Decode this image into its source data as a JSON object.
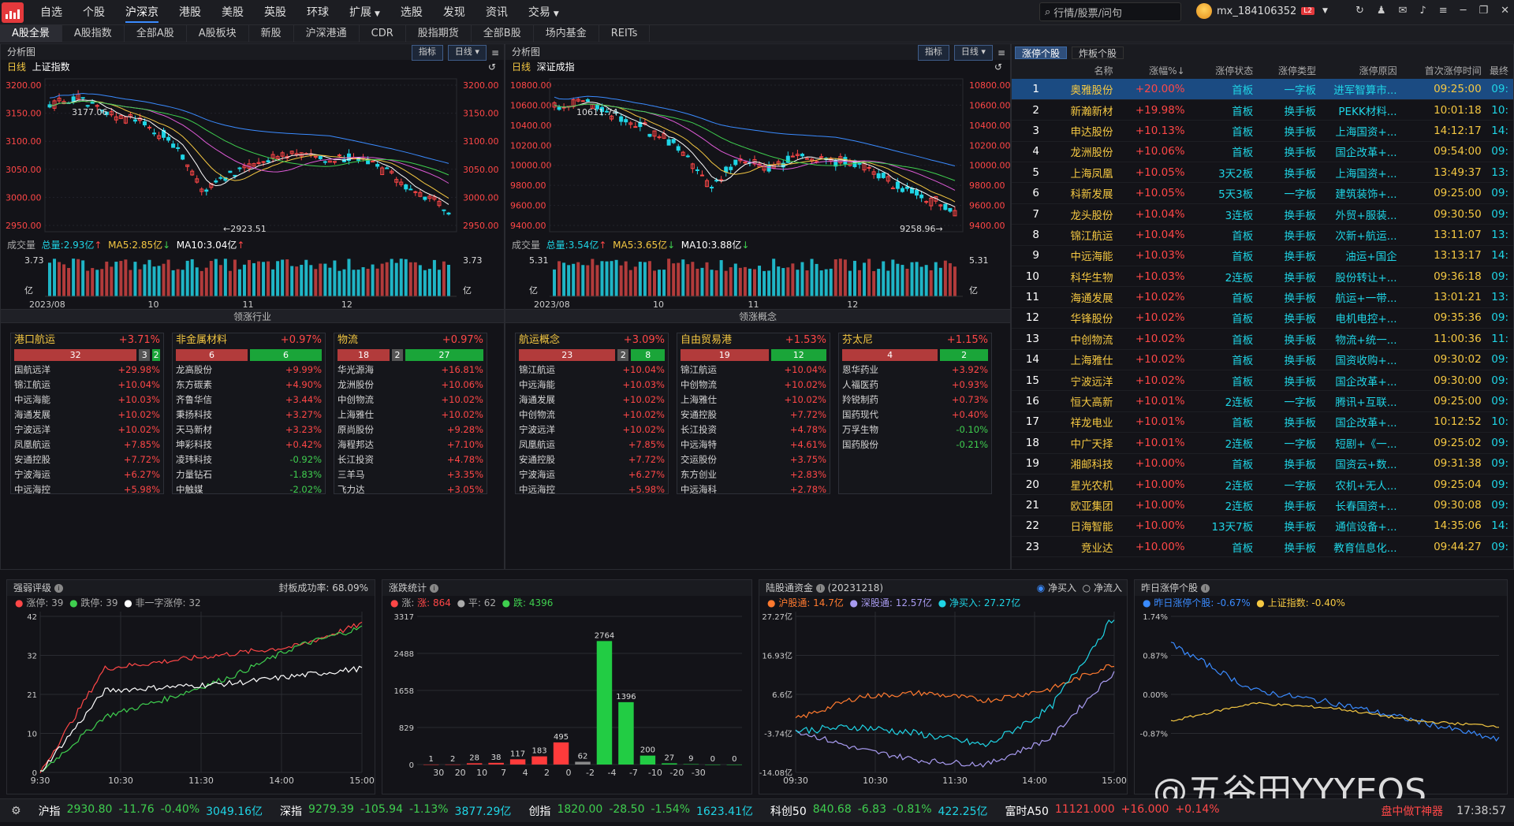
{
  "app": {
    "nav": [
      "自选",
      "个股",
      "沪深京",
      "港股",
      "美股",
      "英股",
      "环球",
      "扩展",
      "选股",
      "发现",
      "资讯",
      "交易"
    ],
    "nav_active": 2,
    "search_placeholder": "行情/股票/问句",
    "username": "mx_184106352",
    "level": "L2"
  },
  "tabs": [
    "A股全景",
    "A股指数",
    "全部A股",
    "A股板块",
    "新股",
    "沪深港通",
    "CDR",
    "股指期货",
    "全部B股",
    "场内基金",
    "REITs"
  ],
  "left_chart": {
    "title": "分析图",
    "btn1": "指标",
    "btn2": "日线",
    "period": "日线",
    "name": "上证指数",
    "high_label": "3177.06",
    "low_label": "←2923.51",
    "yticks": [
      "3200.00",
      "3150.00",
      "3100.00",
      "3050.00",
      "3000.00",
      "2950.00"
    ],
    "vol_label": "成交量",
    "vol_total": "总量:2.93亿",
    "vol_ma5": "MA5:2.85亿",
    "vol_ma10": "MA10:3.04亿",
    "vol_max": "3.73",
    "vol_unit": "亿",
    "xticks": [
      "2023/08",
      "10",
      "11",
      "12"
    ],
    "section": "领涨行业"
  },
  "right_chart": {
    "title": "分析图",
    "btn1": "指标",
    "btn2": "日线",
    "period": "日线",
    "name": "深证成指",
    "high_label": "10611.74",
    "low_label": "9258.96→",
    "yticks": [
      "10800.00",
      "10600.00",
      "10400.00",
      "10200.00",
      "10000.00",
      "9800.00",
      "9600.00",
      "9400.00"
    ],
    "vol_label": "成交量",
    "vol_total": "总量:3.54亿",
    "vol_ma5": "MA5:3.65亿",
    "vol_ma10": "MA10:3.88亿",
    "vol_max": "5.31",
    "vol_unit": "亿",
    "xticks": [
      "2023/08",
      "10",
      "11",
      "12"
    ],
    "section": "领涨概念"
  },
  "industry_boxes": [
    {
      "name": "港口航运",
      "pct": "+3.71%",
      "up": "32",
      "flat": "3",
      "down": "2",
      "rows": [
        [
          "国航远洋",
          "+29.98%"
        ],
        [
          "锦江航运",
          "+10.04%"
        ],
        [
          "中远海能",
          "+10.03%"
        ],
        [
          "海通发展",
          "+10.02%"
        ],
        [
          "宁波远洋",
          "+10.02%"
        ],
        [
          "凤凰航运",
          "+7.85%"
        ],
        [
          "安通控股",
          "+7.72%"
        ],
        [
          "宁波海运",
          "+6.27%"
        ],
        [
          "中远海控",
          "+5.98%"
        ]
      ]
    },
    {
      "name": "非金属材料",
      "pct": "+0.97%",
      "up": "6",
      "flat": "",
      "down": "6",
      "rows": [
        [
          "龙高股份",
          "+9.99%"
        ],
        [
          "东方碳素",
          "+4.90%"
        ],
        [
          "齐鲁华信",
          "+3.44%"
        ],
        [
          "秉扬科技",
          "+3.27%"
        ],
        [
          "天马新材",
          "+3.23%"
        ],
        [
          "坤彩科技",
          "+0.42%"
        ],
        [
          "凌玮科技",
          "-0.92%"
        ],
        [
          "力量钻石",
          "-1.83%"
        ],
        [
          "中触媒",
          "-2.02%"
        ]
      ]
    },
    {
      "name": "物流",
      "pct": "+0.97%",
      "up": "18",
      "flat": "2",
      "down": "27",
      "rows": [
        [
          "华光源海",
          "+16.81%"
        ],
        [
          "龙洲股份",
          "+10.06%"
        ],
        [
          "中创物流",
          "+10.02%"
        ],
        [
          "上海雅仕",
          "+10.02%"
        ],
        [
          "原尚股份",
          "+9.28%"
        ],
        [
          "海程邦达",
          "+7.10%"
        ],
        [
          "长江投资",
          "+4.78%"
        ],
        [
          "三羊马",
          "+3.35%"
        ],
        [
          "飞力达",
          "+3.05%"
        ]
      ]
    }
  ],
  "concept_boxes": [
    {
      "name": "航运概念",
      "pct": "+3.09%",
      "up": "23",
      "flat": "2",
      "down": "8",
      "rows": [
        [
          "锦江航运",
          "+10.04%"
        ],
        [
          "中远海能",
          "+10.03%"
        ],
        [
          "海通发展",
          "+10.02%"
        ],
        [
          "中创物流",
          "+10.02%"
        ],
        [
          "宁波远洋",
          "+10.02%"
        ],
        [
          "凤凰航运",
          "+7.85%"
        ],
        [
          "安通控股",
          "+7.72%"
        ],
        [
          "宁波海运",
          "+6.27%"
        ],
        [
          "中远海控",
          "+5.98%"
        ]
      ]
    },
    {
      "name": "自由贸易港",
      "pct": "+1.53%",
      "up": "19",
      "flat": "",
      "down": "12",
      "rows": [
        [
          "锦江航运",
          "+10.04%"
        ],
        [
          "中创物流",
          "+10.02%"
        ],
        [
          "上海雅仕",
          "+10.02%"
        ],
        [
          "安通控股",
          "+7.72%"
        ],
        [
          "长江投资",
          "+4.78%"
        ],
        [
          "中远海特",
          "+4.61%"
        ],
        [
          "交运股份",
          "+3.75%"
        ],
        [
          "东方创业",
          "+2.83%"
        ],
        [
          "中远海科",
          "+2.78%"
        ]
      ]
    },
    {
      "name": "芬太尼",
      "pct": "+1.15%",
      "up": "4",
      "flat": "",
      "down": "2",
      "rows": [
        [
          "恩华药业",
          "+3.92%"
        ],
        [
          "人福医药",
          "+0.93%"
        ],
        [
          "羚锐制药",
          "+0.73%"
        ],
        [
          "国药现代",
          "+0.40%"
        ],
        [
          "万孚生物",
          "-0.10%"
        ],
        [
          "国药股份",
          "-0.21%"
        ]
      ]
    }
  ],
  "zt": {
    "tab1": "涨停个股",
    "tab2": "炸板个股",
    "headers": [
      "",
      "名称",
      "涨幅%↓",
      "涨停状态",
      "涨停类型",
      "涨停原因",
      "首次涨停时间",
      "最终"
    ],
    "rows": [
      [
        "1",
        "奥雅股份",
        "+20.00%",
        "首板",
        "一字板",
        "进军智算市...",
        "09:25:00",
        "09:"
      ],
      [
        "2",
        "新瀚新材",
        "+19.98%",
        "首板",
        "换手板",
        "PEKK材料...",
        "10:01:18",
        "10:"
      ],
      [
        "3",
        "申达股份",
        "+10.13%",
        "首板",
        "换手板",
        "上海国资+...",
        "14:12:17",
        "14:"
      ],
      [
        "4",
        "龙洲股份",
        "+10.06%",
        "首板",
        "换手板",
        "国企改革+...",
        "09:54:00",
        "09:"
      ],
      [
        "5",
        "上海凤凰",
        "+10.05%",
        "3天2板",
        "换手板",
        "上海国资+...",
        "13:49:37",
        "13:"
      ],
      [
        "6",
        "科新发展",
        "+10.05%",
        "5天3板",
        "一字板",
        "建筑装饰+...",
        "09:25:00",
        "09:"
      ],
      [
        "7",
        "龙头股份",
        "+10.04%",
        "3连板",
        "换手板",
        "外贸+服装...",
        "09:30:50",
        "09:"
      ],
      [
        "8",
        "锦江航运",
        "+10.04%",
        "首板",
        "换手板",
        "次新+航运...",
        "13:11:07",
        "13:"
      ],
      [
        "9",
        "中远海能",
        "+10.03%",
        "首板",
        "换手板",
        "油运+国企",
        "13:13:17",
        "14:"
      ],
      [
        "10",
        "科华生物",
        "+10.03%",
        "2连板",
        "换手板",
        "股份转让+...",
        "09:36:18",
        "09:"
      ],
      [
        "11",
        "海通发展",
        "+10.02%",
        "首板",
        "换手板",
        "航运+一带...",
        "13:01:21",
        "13:"
      ],
      [
        "12",
        "华锋股份",
        "+10.02%",
        "首板",
        "换手板",
        "电机电控+...",
        "09:35:36",
        "09:"
      ],
      [
        "13",
        "中创物流",
        "+10.02%",
        "首板",
        "换手板",
        "物流+统一...",
        "11:00:36",
        "11:"
      ],
      [
        "14",
        "上海雅仕",
        "+10.02%",
        "首板",
        "换手板",
        "国资收购+...",
        "09:30:02",
        "09:"
      ],
      [
        "15",
        "宁波远洋",
        "+10.02%",
        "首板",
        "换手板",
        "国企改革+...",
        "09:30:00",
        "09:"
      ],
      [
        "16",
        "恒大高新",
        "+10.01%",
        "2连板",
        "一字板",
        "腾讯+互联...",
        "09:25:00",
        "09:"
      ],
      [
        "17",
        "祥龙电业",
        "+10.01%",
        "首板",
        "换手板",
        "国企改革+...",
        "10:12:52",
        "10:"
      ],
      [
        "18",
        "中广天择",
        "+10.01%",
        "2连板",
        "一字板",
        "短剧+《一...",
        "09:25:02",
        "09:"
      ],
      [
        "19",
        "湘邮科技",
        "+10.00%",
        "首板",
        "换手板",
        "国资云+数...",
        "09:31:38",
        "09:"
      ],
      [
        "20",
        "星光农机",
        "+10.00%",
        "2连板",
        "一字板",
        "农机+无人...",
        "09:25:04",
        "09:"
      ],
      [
        "21",
        "欧亚集团",
        "+10.00%",
        "2连板",
        "换手板",
        "长春国资+...",
        "09:30:08",
        "09:"
      ],
      [
        "22",
        "日海智能",
        "+10.00%",
        "13天7板",
        "换手板",
        "通信设备+...",
        "14:35:06",
        "14:"
      ],
      [
        "23",
        "竞业达",
        "+10.00%",
        "首板",
        "换手板",
        "教育信息化...",
        "09:44:27",
        "09:"
      ]
    ]
  },
  "bottom": {
    "p1": {
      "title": "强弱评级",
      "seal": "封板成功率: 68.09%",
      "leg_up": "涨停: 39",
      "leg_dn": "跌停: 39",
      "leg_nf": "非一字涨停: 32",
      "yticks": [
        "42",
        "32",
        "21",
        "10",
        "0"
      ],
      "xticks": [
        "9:30",
        "10:30",
        "11:30",
        "14:00",
        "15:00"
      ]
    },
    "p2": {
      "title": "涨跌统计",
      "leg_up": "涨: 864",
      "leg_flat": "平: 62",
      "leg_dn": "跌: 4396",
      "yticks": [
        "3317",
        "2488",
        "1658",
        "829",
        "0"
      ]
    },
    "p3": {
      "title": "陆股通资金",
      "date": "(20231218)",
      "opt1": "净买入",
      "opt2": "净流入",
      "leg_sh": "沪股通: 14.7亿",
      "leg_sz": "深股通: 12.57亿",
      "leg_net": "净买入: 27.27亿",
      "yticks": [
        "27.27亿",
        "16.93亿",
        "6.6亿",
        "-3.74亿",
        "-14.08亿"
      ],
      "xticks": [
        "09:30",
        "10:30",
        "11:30",
        "14:00",
        "15:00"
      ]
    },
    "p4": {
      "title": "昨日涨停个股",
      "leg_a": "昨日涨停个股: -0.67%",
      "leg_b": "上证指数: -0.40%",
      "yticks": [
        "1.74%",
        "0.87%",
        "0.00%",
        "-0.87%"
      ]
    }
  },
  "chart_data": [
    {
      "type": "bar",
      "title": "涨跌统计",
      "categories": [
        "30",
        "20",
        "10",
        "7",
        "4",
        "2",
        "0",
        "-2",
        "-4",
        "-7",
        "-10",
        "-20",
        "-30"
      ],
      "values": [
        1,
        2,
        28,
        38,
        117,
        183,
        495,
        62,
        2764,
        1396,
        200,
        27,
        9,
        0,
        0
      ],
      "labels_note": "",
      "ylim": [
        0,
        3317
      ]
    },
    {
      "type": "line",
      "title": "强弱评级",
      "x": [
        "9:30",
        "10:30",
        "11:30",
        "14:00",
        "15:00"
      ],
      "series": [
        {
          "name": "涨停",
          "values": [
            0,
            28,
            30,
            32,
            34,
            40
          ]
        },
        {
          "name": "跌停",
          "values": [
            0,
            15,
            20,
            26,
            34,
            39
          ]
        },
        {
          "name": "非一字涨停",
          "values": [
            0,
            22,
            23,
            24,
            26,
            28
          ]
        }
      ],
      "ylim": [
        0,
        42
      ]
    },
    {
      "type": "line",
      "title": "陆股通资金",
      "x": [
        "09:30",
        "10:30",
        "11:30",
        "14:00",
        "15:00"
      ],
      "series": [
        {
          "name": "沪股通",
          "values": [
            0,
            6,
            7,
            5,
            8,
            14.7
          ]
        },
        {
          "name": "深股通",
          "values": [
            -3,
            -8,
            -11,
            -12,
            -5,
            12.57
          ]
        },
        {
          "name": "净买入",
          "values": [
            -3,
            -2,
            -4,
            -7,
            3,
            27.27
          ]
        }
      ],
      "ylim": [
        -14.08,
        27.27
      ]
    },
    {
      "type": "line",
      "title": "昨日涨停个股",
      "x": [
        "09:30",
        "10:30",
        "11:30",
        "14:00",
        "15:00"
      ],
      "series": [
        {
          "name": "昨日涨停个股",
          "values": [
            1.2,
            0.3,
            0.05,
            -0.3,
            -0.67
          ]
        },
        {
          "name": "上证指数",
          "values": [
            -0.3,
            0.05,
            -0.05,
            -0.3,
            -0.4
          ]
        }
      ],
      "ylim": [
        -0.87,
        1.74
      ]
    }
  ],
  "status": {
    "items": [
      {
        "name": "沪指",
        "price": "2930.80",
        "chg": "-11.76",
        "pct": "-0.40%",
        "amt": "3049.16亿"
      },
      {
        "name": "深指",
        "price": "9279.39",
        "chg": "-105.94",
        "pct": "-1.13%",
        "amt": "3877.29亿"
      },
      {
        "name": "创指",
        "price": "1820.00",
        "chg": "-28.50",
        "pct": "-1.54%",
        "amt": "1623.41亿"
      },
      {
        "name": "科创50",
        "price": "840.68",
        "chg": "-6.83",
        "pct": "-0.81%",
        "amt": "422.25亿"
      },
      {
        "name": "富时A50",
        "price": "11121.000",
        "chg": "+16.000",
        "pct": "+0.14%",
        "amt": ""
      }
    ],
    "time": "17:38:57",
    "tool": "盘中做T神器"
  },
  "watermark": "@五谷田YYYEOS"
}
